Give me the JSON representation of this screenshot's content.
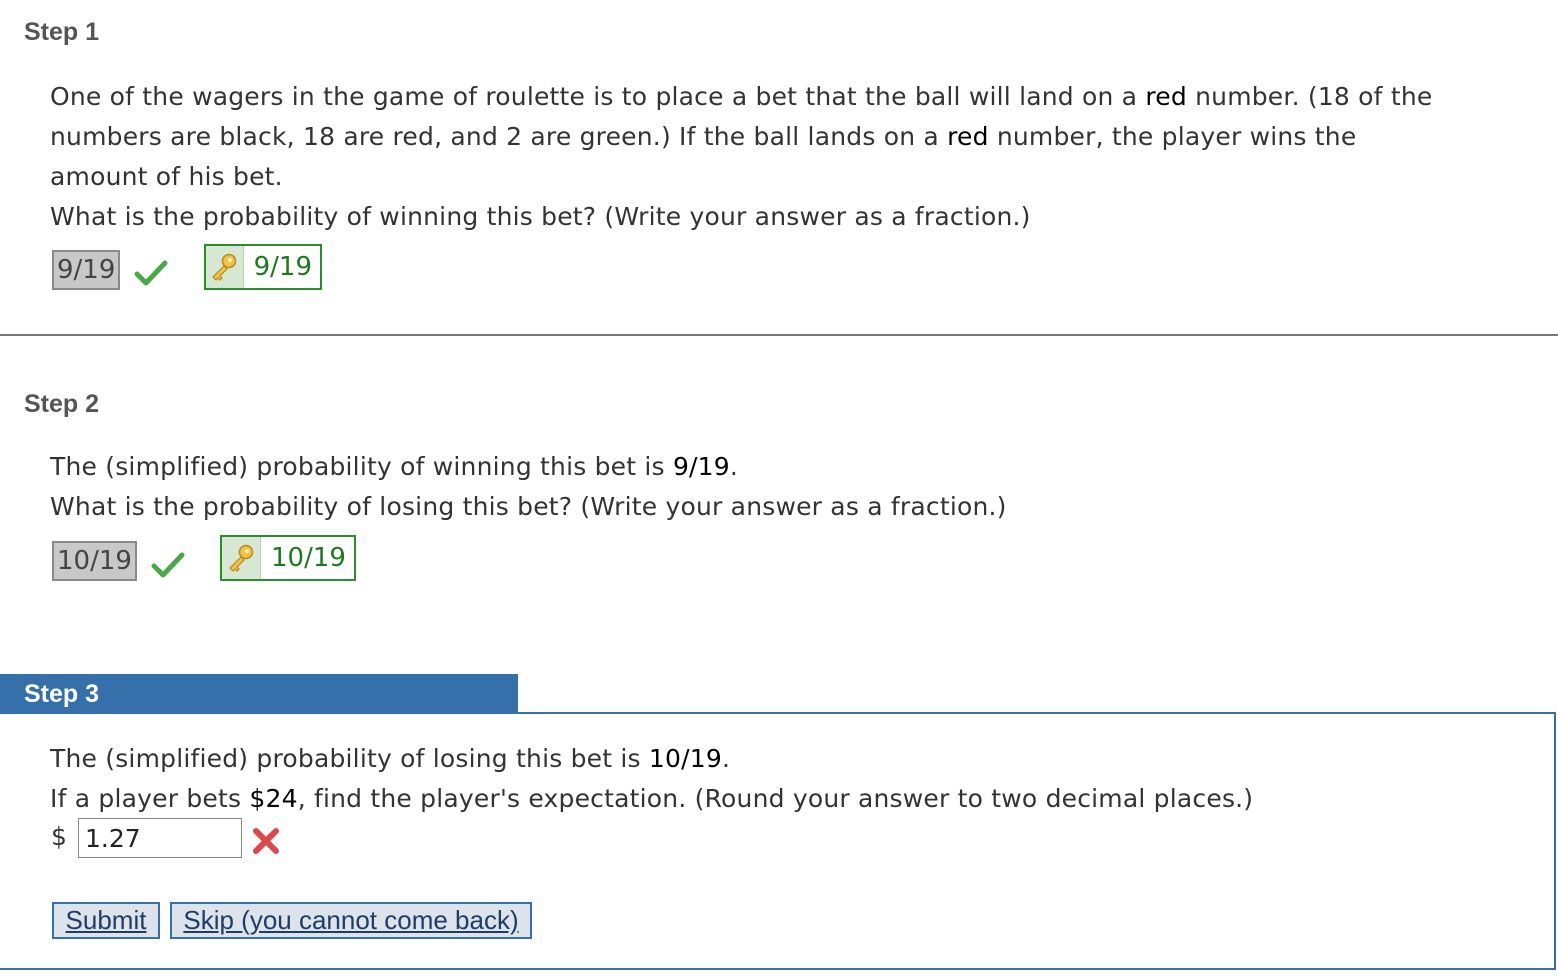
{
  "step1": {
    "title": "Step 1",
    "line1_a": "One of the wagers in the game of roulette is to place a bet that the ball will land on a ",
    "line1_red": "red",
    "line1_b": " number. (18 of the",
    "line2_a": "numbers are black, 18 are red, and 2 are green.) If the ball lands on a ",
    "line2_red": "red",
    "line2_b": " number, the player wins the",
    "line3": "amount of his bet.",
    "question": "What is the probability of winning this bet? (Write your answer as a fraction.)",
    "given_answer": "9/19",
    "key_answer": "9/19"
  },
  "step2": {
    "title": "Step 2",
    "line1_a": "The (simplified) probability of winning this bet is ",
    "line1_val": "9/19",
    "line1_b": ".",
    "question": "What is the probability of losing this bet? (Write your answer as a fraction.)",
    "given_answer": "10/19",
    "key_answer": "10/19"
  },
  "step3": {
    "title": "Step 3",
    "line1_a": "The (simplified) probability of losing this bet is ",
    "line1_val": "10/19",
    "line1_b": ".",
    "line2_a": "If a player bets ",
    "line2_val": "$24",
    "line2_b": ", find the player's expectation. (Round your answer to two decimal places.)",
    "currency": "$",
    "input_value": "1.27"
  },
  "buttons": {
    "submit": "Submit",
    "skip": "Skip (you cannot come back)"
  },
  "icons": {
    "correct": "check-icon",
    "incorrect": "x-icon",
    "key": "key-icon"
  },
  "colors": {
    "accent": "#3570aa",
    "correct_green": "#1e7a1e",
    "error_red": "#e0474c"
  }
}
